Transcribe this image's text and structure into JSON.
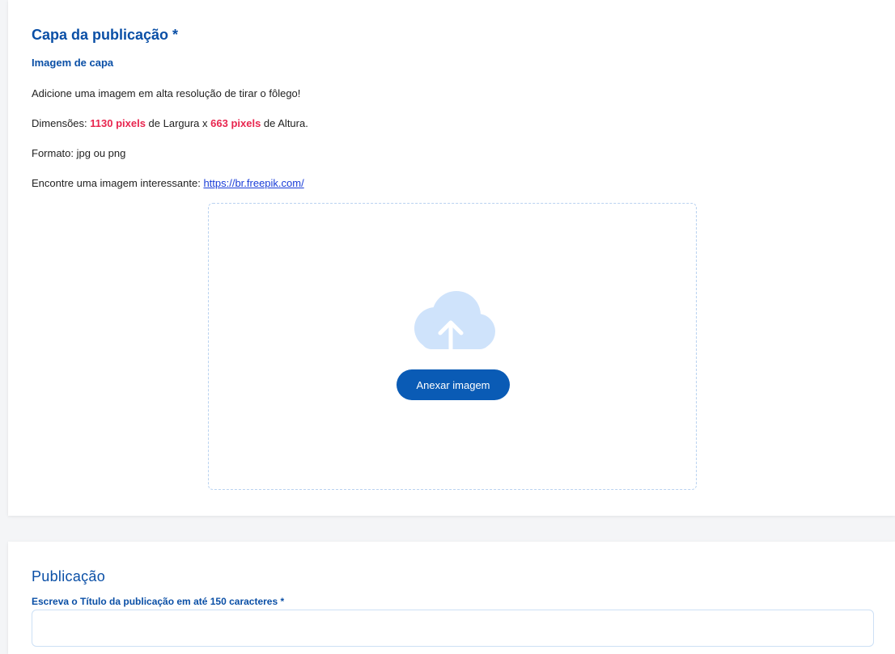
{
  "cover": {
    "title": "Capa da publicação *",
    "subtitle": "Imagem de capa",
    "description": "Adicione uma imagem em alta resolução de tirar o fôlego!",
    "dimensions": {
      "prefix": "Dimensões: ",
      "width_value": "1130 pixels",
      "middle": " de Largura x ",
      "height_value": "663 pixels",
      "suffix": " de Altura."
    },
    "format": "Formato: jpg ou png",
    "find_image": {
      "prefix": "Encontre uma imagem interessante: ",
      "link_text": "https://br.freepik.com/"
    },
    "upload": {
      "icon": "cloud-upload-icon",
      "button_label": "Anexar imagem"
    }
  },
  "publication": {
    "title": "Publicação",
    "title_field_label": "Escreva o Título da publicação em até 150 caracteres *",
    "title_field_value": ""
  },
  "colors": {
    "primary": "#0a4fa6",
    "button": "#0a5bb5",
    "highlight": "#e8264f",
    "link": "#1a3ed8",
    "cloud": "#cfe3fb"
  }
}
